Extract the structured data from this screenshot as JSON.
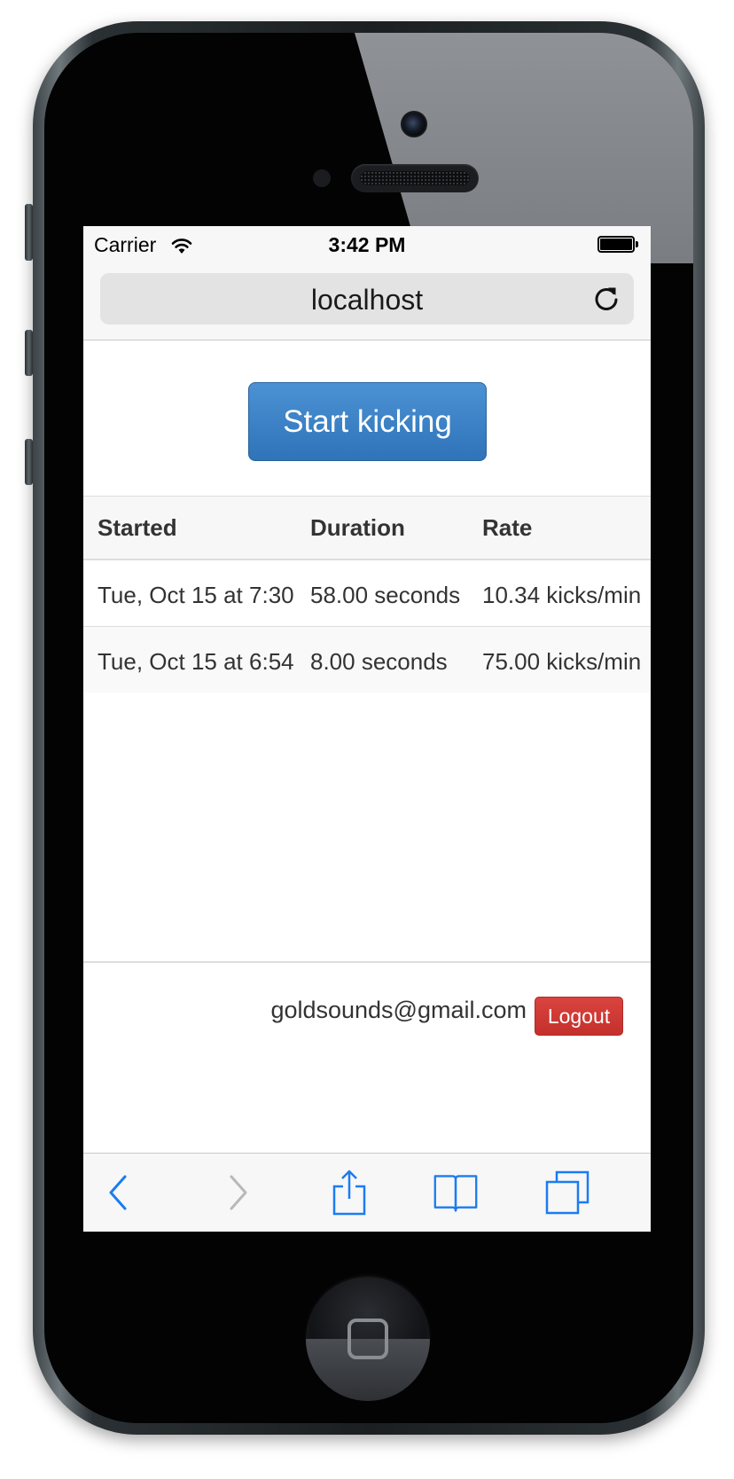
{
  "statusbar": {
    "carrier": "Carrier",
    "time": "3:42 PM"
  },
  "browser": {
    "url": "localhost"
  },
  "page": {
    "start_button": "Start kicking",
    "table": {
      "headers": [
        "Started",
        "Duration",
        "Rate"
      ],
      "rows": [
        {
          "started": "Tue, Oct 15 at 7:30",
          "duration": "58.00 seconds",
          "rate": "10.34 kicks/min"
        },
        {
          "started": "Tue, Oct 15 at 6:54",
          "duration": "8.00 seconds",
          "rate": "75.00 kicks/min"
        }
      ]
    },
    "user_email": "goldsounds@gmail.com",
    "logout_label": "Logout"
  },
  "toolbar": {
    "icons": [
      "back-icon",
      "forward-icon",
      "share-icon",
      "bookmarks-icon",
      "tabs-icon"
    ]
  },
  "colors": {
    "primary": "#3379bf",
    "danger": "#d2322d",
    "ios_blue": "#1a7cf2",
    "ios_disabled": "#b8b8b8"
  }
}
